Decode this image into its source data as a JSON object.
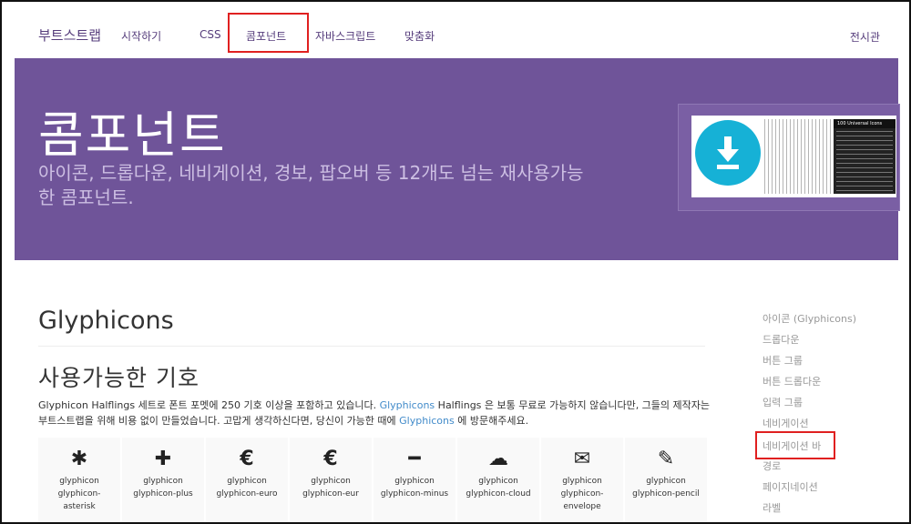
{
  "navbar": {
    "brand": "부트스트랩",
    "items": [
      "시작하기",
      "CSS",
      "콤포넌트",
      "자바스크립트",
      "맞춤화"
    ],
    "right": "전시관"
  },
  "hero": {
    "title": "콤포넌트",
    "subtitle_line1": "아이콘, 드롭다운, 네비게이션, 경보, 팝오버 등 12개도 넘는 재사용가능",
    "subtitle_line2": "한 콤포넌트.",
    "ad_banner_text": "100 Universal Icons"
  },
  "content": {
    "heading": "Glyphicons",
    "subheading": "사용가능한 기호",
    "para_part1": "Glyphicon Halflings 세트로 폰트 포멧에 250 기호 이상을 포함하고 있습니다. ",
    "para_link1": "Glyphicons",
    "para_part2": " Halflings 은 보통 무료로 가능하지 않습니다만, 그들의 제작자는 부트스트랩을 위해 비용 없이 만들었습니다. 고맙게 생각하신다면, 당신이 가능한 때에 ",
    "para_link2": "Glyphicons",
    "para_part3": " 에 방문해주세요."
  },
  "glyphs": [
    {
      "icon": "asterisk",
      "symbol": "✱",
      "label": "glyphicon glyphicon-asterisk"
    },
    {
      "icon": "plus",
      "symbol": "✚",
      "label": "glyphicon glyphicon-plus"
    },
    {
      "icon": "euro",
      "symbol": "€",
      "label": "glyphicon glyphicon-euro"
    },
    {
      "icon": "eur",
      "symbol": "€",
      "label": "glyphicon glyphicon-eur"
    },
    {
      "icon": "minus",
      "symbol": "━",
      "label": "glyphicon glyphicon-minus"
    },
    {
      "icon": "cloud",
      "symbol": "☁",
      "label": "glyphicon glyphicon-cloud"
    },
    {
      "icon": "envelope",
      "symbol": "✉",
      "label": "glyphicon glyphicon-envelope"
    },
    {
      "icon": "pencil",
      "symbol": "✎",
      "label": "glyphicon glyphicon-pencil"
    }
  ],
  "sidenav": {
    "items": [
      "아이콘 (Glyphicons)",
      "드롭다운",
      "버튼 그룹",
      "버튼 드롭다운",
      "입력 그룹",
      "네비게이션",
      "네비게이션 바",
      "경로",
      "페이지네이션",
      "라벨"
    ]
  },
  "colors": {
    "brand_purple": "#563d7c",
    "hero_bg": "#6f5499",
    "highlight_red": "#e02020",
    "link_blue": "#428bca"
  }
}
